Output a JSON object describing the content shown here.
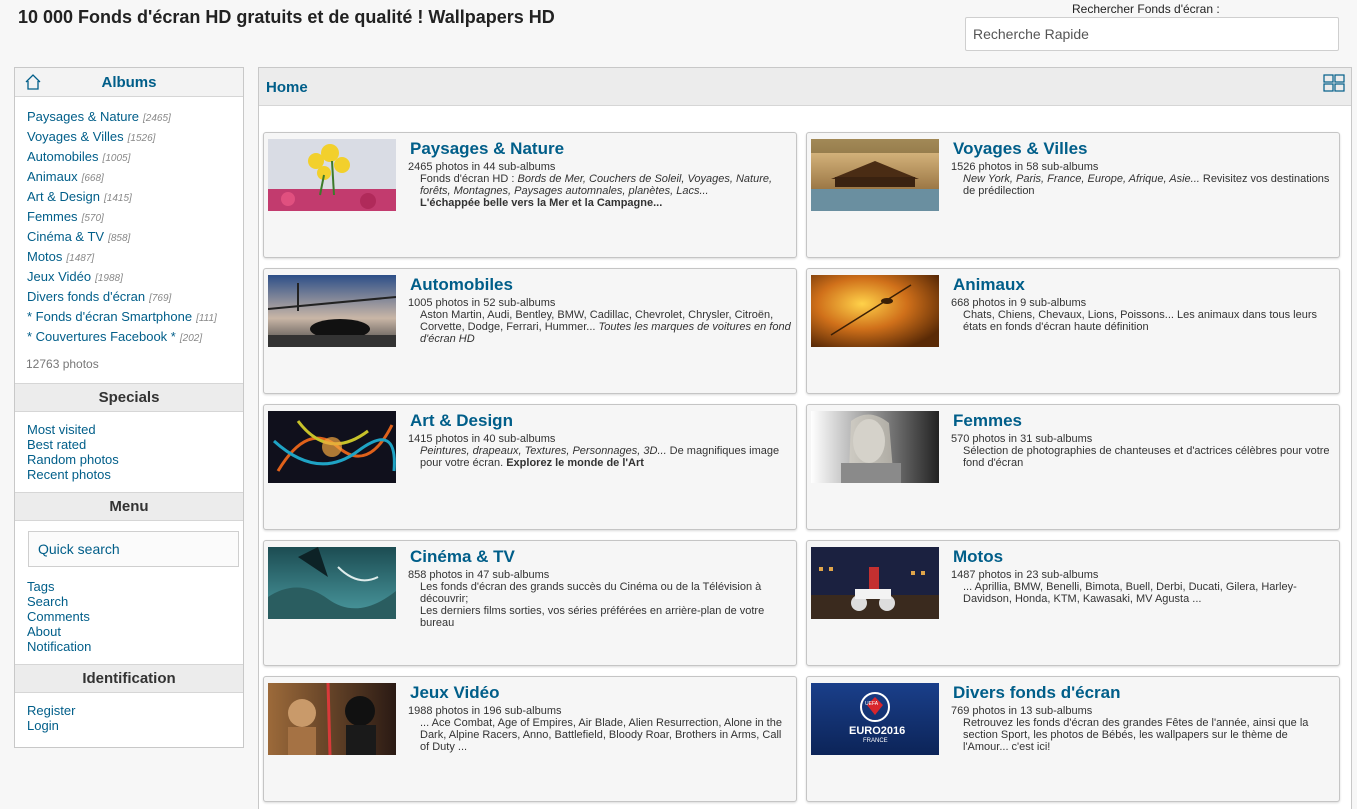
{
  "header": {
    "site_title": "10 000 Fonds d'écran HD gratuits et de qualité ! Wallpapers HD",
    "search_label": "Rechercher Fonds d'écran :",
    "search_placeholder": "Recherche Rapide"
  },
  "sidebar": {
    "albums_heading": "Albums",
    "categories": [
      {
        "name": "Paysages & Nature",
        "count": "[2465]"
      },
      {
        "name": "Voyages & Villes",
        "count": "[1526]"
      },
      {
        "name": "Automobiles",
        "count": "[1005]"
      },
      {
        "name": "Animaux",
        "count": "[668]"
      },
      {
        "name": "Art & Design",
        "count": "[1415]"
      },
      {
        "name": "Femmes",
        "count": "[570]"
      },
      {
        "name": "Cinéma & TV",
        "count": "[858]"
      },
      {
        "name": "Motos",
        "count": "[1487]"
      },
      {
        "name": "Jeux Vidéo",
        "count": "[1988]"
      },
      {
        "name": "Divers fonds d'écran",
        "count": "[769]"
      },
      {
        "name": "* Fonds d'écran Smartphone",
        "count": "[111]"
      },
      {
        "name": "* Couvertures Facebook *",
        "count": "[202]"
      }
    ],
    "photo_total": "12763 photos",
    "specials_heading": "Specials",
    "specials": [
      "Most visited",
      "Best rated",
      "Random photos",
      "Recent photos"
    ],
    "menu_heading": "Menu",
    "quick_search": "Quick search",
    "menu_items": [
      "Tags",
      "Search",
      "Comments",
      "About",
      "Notification"
    ],
    "identification_heading": "Identification",
    "identification_items": [
      "Register",
      "Login"
    ]
  },
  "main": {
    "breadcrumb": "Home",
    "albums": [
      {
        "title": "Paysages & Nature",
        "meta": "2465 photos in 44 sub-albums",
        "desc": [
          {
            "t": "Fonds d'écran HD : "
          },
          {
            "i": "Bords de Mer, Couchers de Soleil, Voyages, Nature, forêts, Montagnes, Paysages automnales, planètes, Lacs..."
          },
          {
            "br": true
          },
          {
            "b": "L'échappée belle vers la Mer et la Campagne..."
          }
        ]
      },
      {
        "title": "Voyages & Villes",
        "meta": "1526 photos in 58 sub-albums",
        "desc": [
          {
            "i": "New York, Paris, France, Europe, Afrique, Asie..."
          },
          {
            "t": " Revisitez vos destinations de prédilection"
          }
        ]
      },
      {
        "title": "Automobiles",
        "meta": "1005 photos in 52 sub-albums",
        "desc": [
          {
            "t": "Aston Martin, Audi, Bentley, BMW, Cadillac, Chevrolet, Chrysler, Citroën, Corvette, Dodge, Ferrari, Hummer... "
          },
          {
            "i": "Toutes les marques de voitures en fond d'écran HD"
          }
        ]
      },
      {
        "title": "Animaux",
        "meta": "668 photos in 9 sub-albums",
        "desc": [
          {
            "t": "Chats, Chiens, Chevaux, Lions, Poissons... Les animaux dans tous leurs états en fonds d'écran haute définition"
          }
        ]
      },
      {
        "title": "Art & Design",
        "meta": "1415 photos in 40 sub-albums",
        "desc": [
          {
            "i": "Peintures, drapeaux, Textures, Personnages, 3D..."
          },
          {
            "t": " De magnifiques image pour votre écran. "
          },
          {
            "b": "Explorez le monde de l'Art"
          }
        ]
      },
      {
        "title": "Femmes",
        "meta": "570 photos in 31 sub-albums",
        "desc": [
          {
            "t": "Sélection de photographies de chanteuses et d'actrices célèbres pour votre fond d'écran"
          }
        ]
      },
      {
        "title": "Cinéma & TV",
        "meta": "858 photos in 47 sub-albums",
        "desc": [
          {
            "t": "Les fonds d'écran des grands succès du Cinéma ou de la Télévision à découvrir;"
          },
          {
            "br": true
          },
          {
            "t": "Les derniers films sorties, vos séries préférées en arrière-plan de votre bureau"
          }
        ]
      },
      {
        "title": "Motos",
        "meta": "1487 photos in 23 sub-albums",
        "desc": [
          {
            "t": "... Aprillia, BMW, Benelli, Bimota, Buell, Derbi, Ducati, Gilera, Harley-Davidson, Honda, KTM, Kawasaki, MV Agusta ..."
          }
        ]
      },
      {
        "title": "Jeux Vidéo",
        "meta": "1988 photos in 196 sub-albums",
        "desc": [
          {
            "t": "... Ace Combat, Age of Empires, Air Blade, Alien Resurrection, Alone in the Dark, Alpine Racers, Anno, Battlefield, Bloody Roar, Brothers in Arms, Call of Duty ..."
          }
        ]
      },
      {
        "title": "Divers fonds d'écran",
        "meta": "769 photos in 13 sub-albums",
        "desc": [
          {
            "t": "Retrouvez les fonds d'écran des grandes Fêtes de l'année, ainsi que la section Sport, les photos de Bébés, les wallpapers sur le thème de l'Amour... c'est ici!"
          }
        ]
      }
    ],
    "thumb_badge_text": [
      "UEFA",
      "EURO2016",
      "FRANCE"
    ]
  },
  "colors": {
    "link": "#005e89",
    "panel_bg": "#ececec",
    "page_bg": "#f7f7f7"
  }
}
